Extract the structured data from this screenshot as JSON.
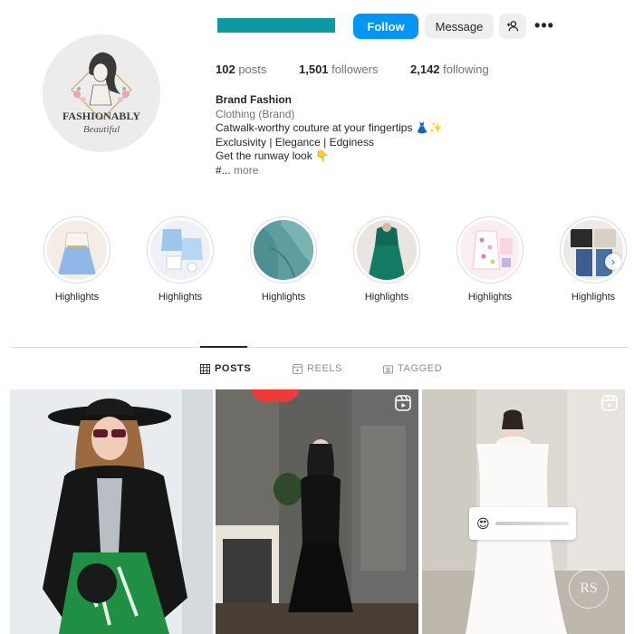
{
  "profile": {
    "follow_label": "Follow",
    "message_label": "Message",
    "more_label": "•••",
    "username_redacted_color": "#0b9aa3",
    "accent_color": "#0095f6",
    "avatar_logo": {
      "title": "FASHIONABLY",
      "subtitle": "Beautiful"
    }
  },
  "stats": {
    "posts_count": "102",
    "posts_label": "posts",
    "followers_count": "1,501",
    "followers_label": "followers",
    "following_count": "2,142",
    "following_label": "following"
  },
  "bio": {
    "name": "Brand Fashion",
    "category": "Clothing (Brand)",
    "line1": "Catwalk-worthy couture at your fingertips 👗✨",
    "line2": "Exclusivity | Elegance | Edginess",
    "line3": "Get the runway look 👇",
    "line4_prefix": "#...",
    "more_label": "more"
  },
  "highlights": [
    {
      "label": "Highlights"
    },
    {
      "label": "Highlights"
    },
    {
      "label": "Highlights"
    },
    {
      "label": "Highlights"
    },
    {
      "label": "Highlights"
    },
    {
      "label": "Highlights"
    }
  ],
  "tabs": {
    "posts": "POSTS",
    "reels": "REELS",
    "tagged": "TAGGED"
  },
  "posts": [
    {
      "icon": null
    },
    {
      "icon": "reel-icon"
    },
    {
      "icon": "reel-icon",
      "slider_emoji": "😍"
    }
  ],
  "watermark_text": "RS"
}
